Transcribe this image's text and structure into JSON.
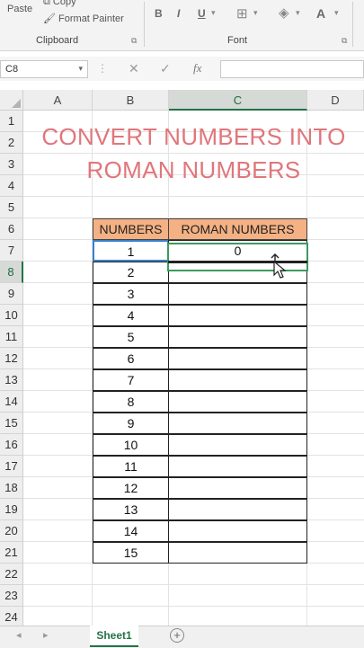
{
  "ribbon": {
    "paste_label": "Paste",
    "copy_label": "Copy",
    "format_painter_label": "Format Painter",
    "clipboard_group": "Clipboard",
    "font_group": "Font",
    "bold": "B",
    "italic": "I",
    "underline": "U",
    "font_color_letter": "A"
  },
  "formula_bar": {
    "name_box": "C8",
    "fx": "fx",
    "cancel": "✕",
    "enter": "✓",
    "formula": ""
  },
  "columns": [
    "A",
    "B",
    "C",
    "D"
  ],
  "rows": [
    "1",
    "2",
    "3",
    "4",
    "5",
    "6",
    "7",
    "8",
    "9",
    "10",
    "11",
    "12",
    "13",
    "14",
    "15",
    "16",
    "17",
    "18",
    "19",
    "20",
    "21",
    "22",
    "23",
    "24"
  ],
  "title": {
    "line1": "CONVERT NUMBERS INTO",
    "line2": "ROMAN NUMBERS"
  },
  "table": {
    "header_numbers": "NUMBERS",
    "header_roman": "ROMAN NUMBERS",
    "numbers": [
      "1",
      "2",
      "3",
      "4",
      "5",
      "6",
      "7",
      "8",
      "9",
      "10",
      "11",
      "12",
      "13",
      "14",
      "15"
    ],
    "roman_first": "0"
  },
  "sheet_tab": "Sheet1",
  "add_sheet": "+",
  "colors": {
    "accent": "#217346",
    "title": "#e0767b",
    "header_fill": "#f4b183"
  }
}
